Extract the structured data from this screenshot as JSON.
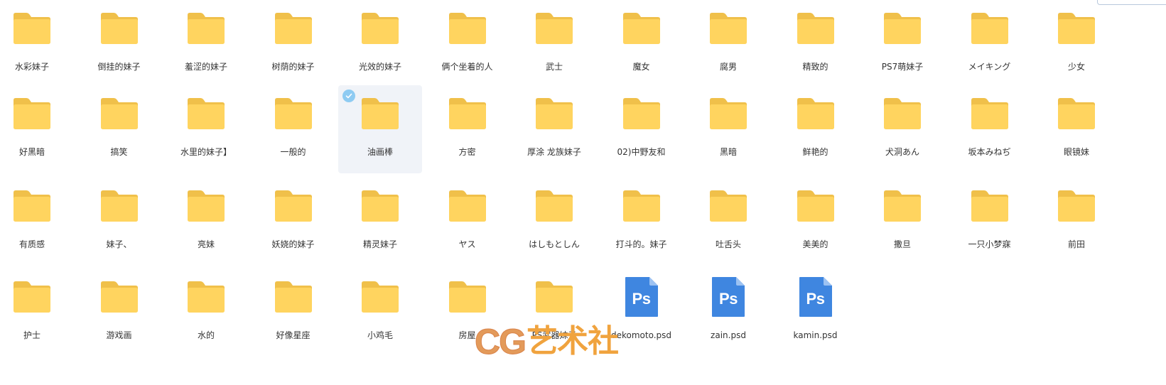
{
  "files": [
    {
      "name": "水彩妹子",
      "type": "folder"
    },
    {
      "name": "倒挂的妹子",
      "type": "folder"
    },
    {
      "name": "羞涩的妹子",
      "type": "folder"
    },
    {
      "name": "树荫的妹子",
      "type": "folder"
    },
    {
      "name": "光效的妹子",
      "type": "folder"
    },
    {
      "name": "俩个坐着的人",
      "type": "folder"
    },
    {
      "name": "武士",
      "type": "folder"
    },
    {
      "name": "魔女",
      "type": "folder"
    },
    {
      "name": "腐男",
      "type": "folder"
    },
    {
      "name": "精致的",
      "type": "folder"
    },
    {
      "name": "PS7萌妹子",
      "type": "folder"
    },
    {
      "name": "メイキング",
      "type": "folder"
    },
    {
      "name": "少女",
      "type": "folder"
    },
    {
      "name": "好黑暗",
      "type": "folder"
    },
    {
      "name": "搞笑",
      "type": "folder"
    },
    {
      "name": "水里的妹子】",
      "type": "folder"
    },
    {
      "name": "一般的",
      "type": "folder"
    },
    {
      "name": "油画棒",
      "type": "folder",
      "selected": true
    },
    {
      "name": "方密",
      "type": "folder"
    },
    {
      "name": "厚涂 龙族妹子",
      "type": "folder"
    },
    {
      "name": "02)中野友和",
      "type": "folder"
    },
    {
      "name": "黑暗",
      "type": "folder"
    },
    {
      "name": "鲜艳的",
      "type": "folder"
    },
    {
      "name": "犬洞あん",
      "type": "folder"
    },
    {
      "name": "坂本みねぢ",
      "type": "folder"
    },
    {
      "name": "眼镜妹",
      "type": "folder"
    },
    {
      "name": "有质感",
      "type": "folder"
    },
    {
      "name": "妹子、",
      "type": "folder"
    },
    {
      "name": "亮妹",
      "type": "folder"
    },
    {
      "name": "妖娆的妹子",
      "type": "folder"
    },
    {
      "name": "精灵妹子",
      "type": "folder"
    },
    {
      "name": "ヤス",
      "type": "folder"
    },
    {
      "name": "はしもとしん",
      "type": "folder"
    },
    {
      "name": "打斗的。妹子",
      "type": "folder"
    },
    {
      "name": "吐舌头",
      "type": "folder"
    },
    {
      "name": "美美的",
      "type": "folder"
    },
    {
      "name": "撒旦",
      "type": "folder"
    },
    {
      "name": "一只小梦寐",
      "type": "folder"
    },
    {
      "name": "前田",
      "type": "folder"
    },
    {
      "name": "护士",
      "type": "folder"
    },
    {
      "name": "游戏画",
      "type": "folder"
    },
    {
      "name": "水的",
      "type": "folder"
    },
    {
      "name": "好像星座",
      "type": "folder"
    },
    {
      "name": "小鸡毛",
      "type": "folder"
    },
    {
      "name": "房屋",
      "type": "folder"
    },
    {
      "name": "PS武器妹子",
      "type": "folder"
    },
    {
      "name": "dekomoto.psd",
      "type": "psd",
      "badge": "Ps"
    },
    {
      "name": "zain.psd",
      "type": "psd",
      "badge": "Ps"
    },
    {
      "name": "kamin.psd",
      "type": "psd",
      "badge": "Ps"
    }
  ],
  "watermark": {
    "latin": "CG",
    "chinese": "艺术社"
  },
  "colors": {
    "folder_back": "#F0C04A",
    "folder_front": "#FFD45F",
    "psd_blue": "#3F86E0",
    "psd_fold": "#9CC2F2",
    "selected_bg": "#F0F3F8",
    "check": "#8ECBF2"
  }
}
